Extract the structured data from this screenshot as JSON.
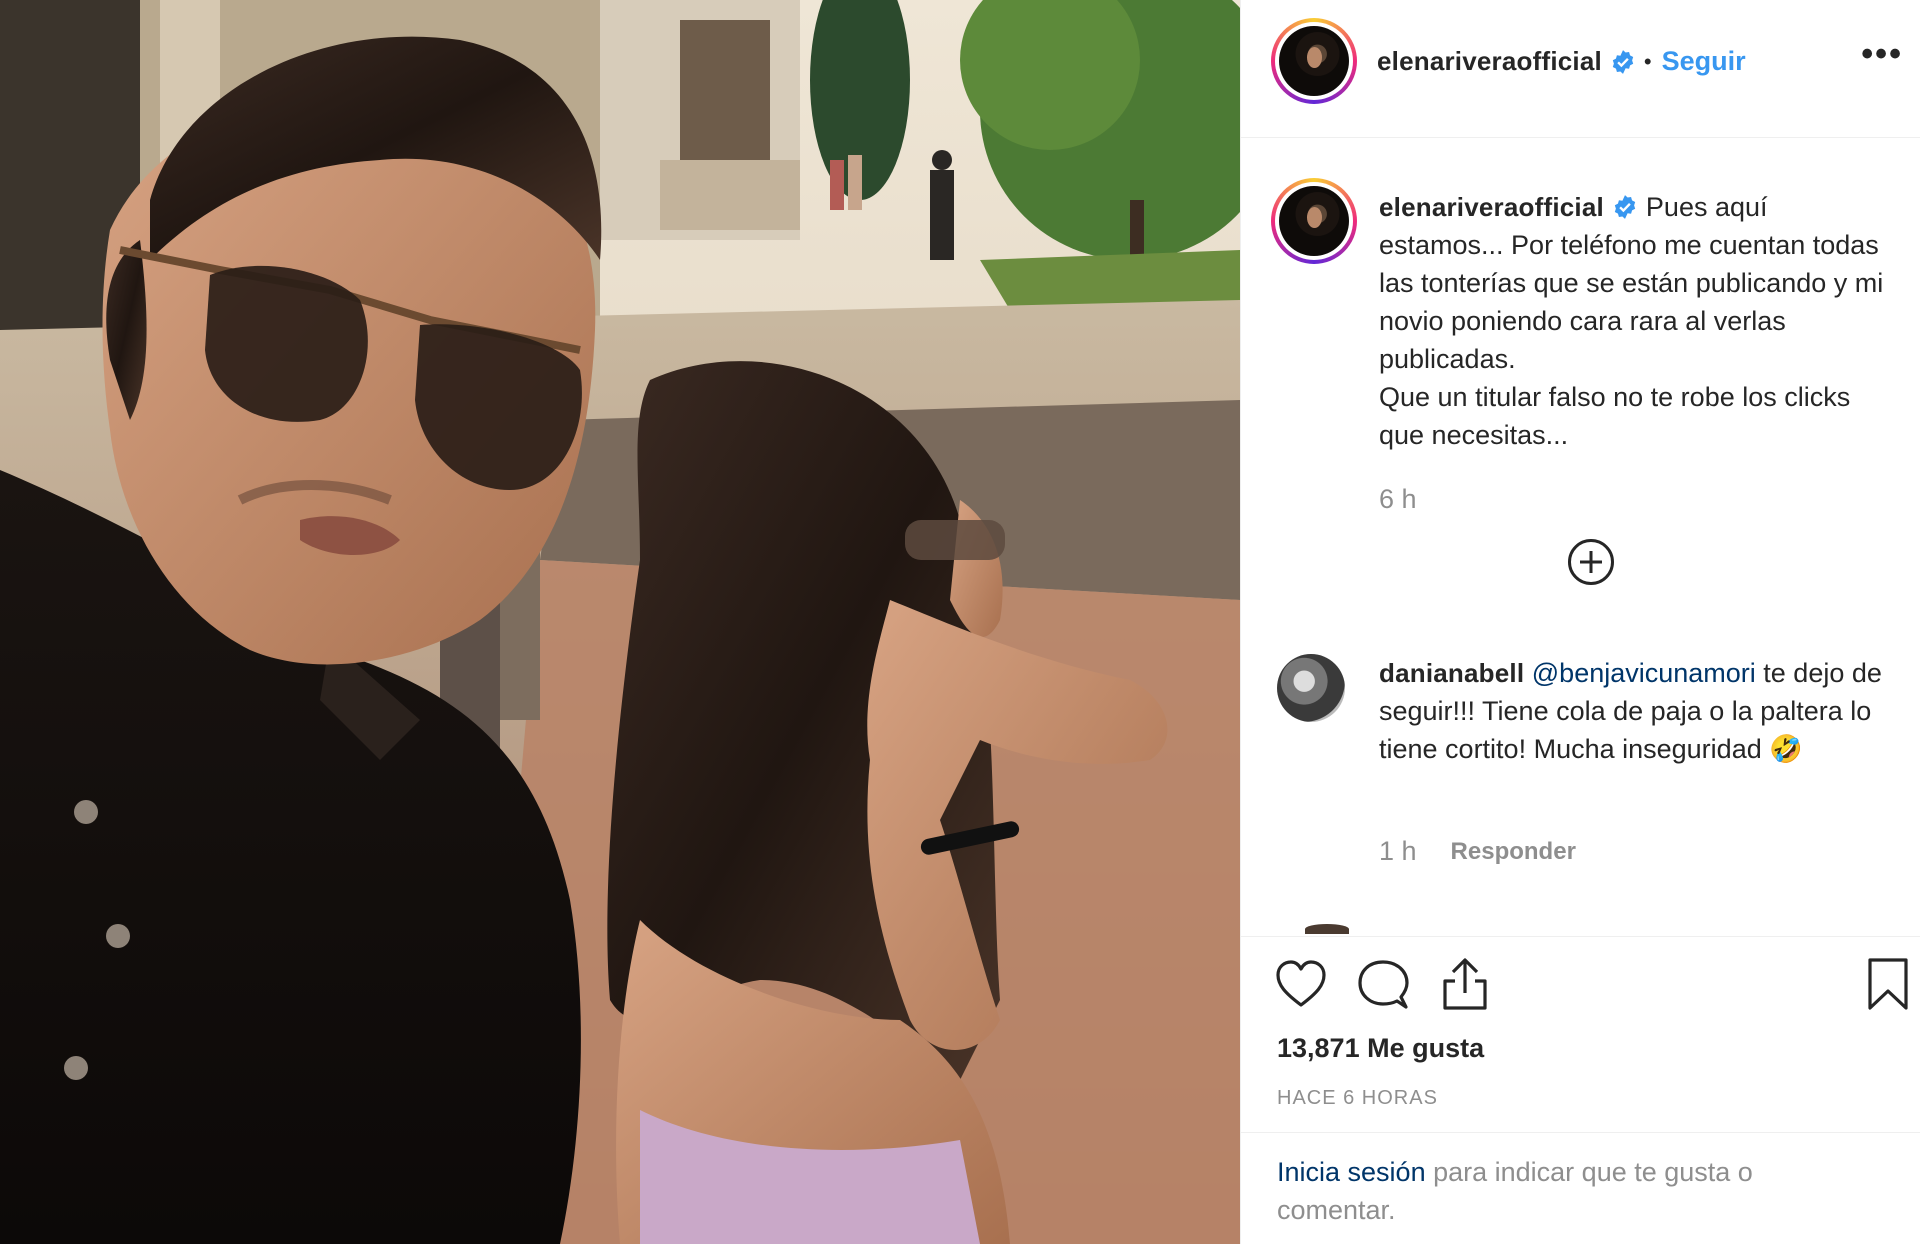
{
  "post": {
    "username": "elenariveraofficial",
    "follow_label": "Seguir",
    "separator": "•",
    "more_label": "•••"
  },
  "caption": {
    "lines": [
      "Pues aquí estamos... Por teléfono me cuentan todas las tonterías que se están publicando y mi novio poniendo cara rara al verlas publicadas.",
      "Que un titular falso no te robe los clicks que necesitas..."
    ],
    "time": "6 h"
  },
  "comment": {
    "username": "danianabell",
    "mention": "@benjavicunamori",
    "text": " te dejo de seguir!!! Tiene cola de paja o la paltera lo tiene cortito! Mucha inseguridad",
    "emoji": "🤣",
    "time": "1 h",
    "reply_label": "Responder"
  },
  "actions": {
    "likes": "13,871 Me gusta",
    "timestamp": "HACE 6 HORAS"
  },
  "login": {
    "link": "Inicia sesión",
    "text": " para indicar que te gusta o comentar."
  },
  "colors": {
    "accent_blue": "#3897f0",
    "link_dark": "#003569",
    "muted": "#8e8e8e",
    "text": "#262626"
  },
  "icons": [
    "heart-icon",
    "comment-icon",
    "share-icon",
    "bookmark-icon",
    "add-comments-icon",
    "verified-badge-icon",
    "more-options-icon"
  ]
}
